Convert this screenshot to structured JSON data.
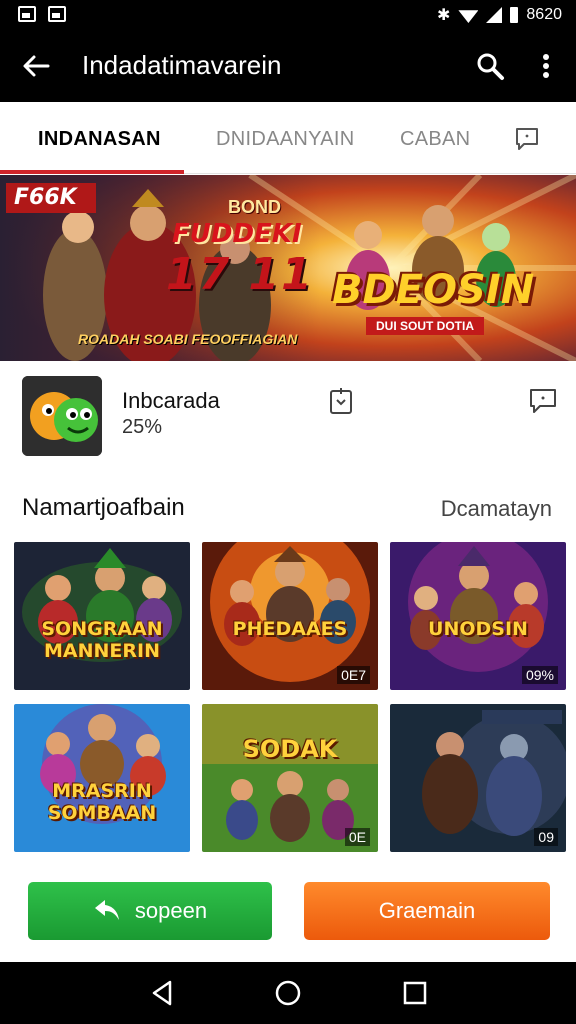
{
  "status_bar": {
    "time": "8620"
  },
  "app_bar": {
    "title": "Indadatimavarein"
  },
  "tabs": [
    {
      "label": "INDANASAN",
      "active": true
    },
    {
      "label": "DNIDAANYAIN",
      "active": false
    },
    {
      "label": "CABAN",
      "active": false
    }
  ],
  "hero": {
    "corner_label": "F66K",
    "headline_1": "FUDDEKI",
    "headline_top": "BOND",
    "headline_num": "17 11",
    "brand": "BDEOSIN",
    "brand_sub": "DUI SOUT DOTIA",
    "caption": "ROADAH SOABI FEOOFFIAGIAN"
  },
  "app": {
    "name": "Inbcarada",
    "percent": "25%"
  },
  "section": {
    "title": "Namartjoafbain",
    "link": "Dcamatayn"
  },
  "cards": [
    {
      "label": "SONGRAAN MANNERIN",
      "badge": "",
      "bg": [
        "#1d2436",
        "#2a5a2a"
      ]
    },
    {
      "label": "PHEDAAES",
      "badge": "0E7",
      "bg": [
        "#e35a14",
        "#5a1a0a"
      ]
    },
    {
      "label": "UNODSIN",
      "badge": "09%",
      "bg": [
        "#3a1a6a",
        "#8a2a8a"
      ]
    },
    {
      "label": "MRASRIN SOMBAAN",
      "badge": "",
      "bg": [
        "#2a8ad8",
        "#7a3a9a"
      ]
    },
    {
      "label": "SODAK",
      "badge": "0E",
      "bg": [
        "#4a8a2a",
        "#c89a2a"
      ]
    },
    {
      "label": "",
      "badge": "09",
      "bg": [
        "#1a2a3a",
        "#3a3a4a"
      ]
    }
  ],
  "buttons": {
    "primary": "sopeen",
    "secondary": "Graemain"
  },
  "colors": {
    "accent": "#d0242a",
    "primary_button": "#22aa3c",
    "secondary_button": "#f26a16"
  }
}
